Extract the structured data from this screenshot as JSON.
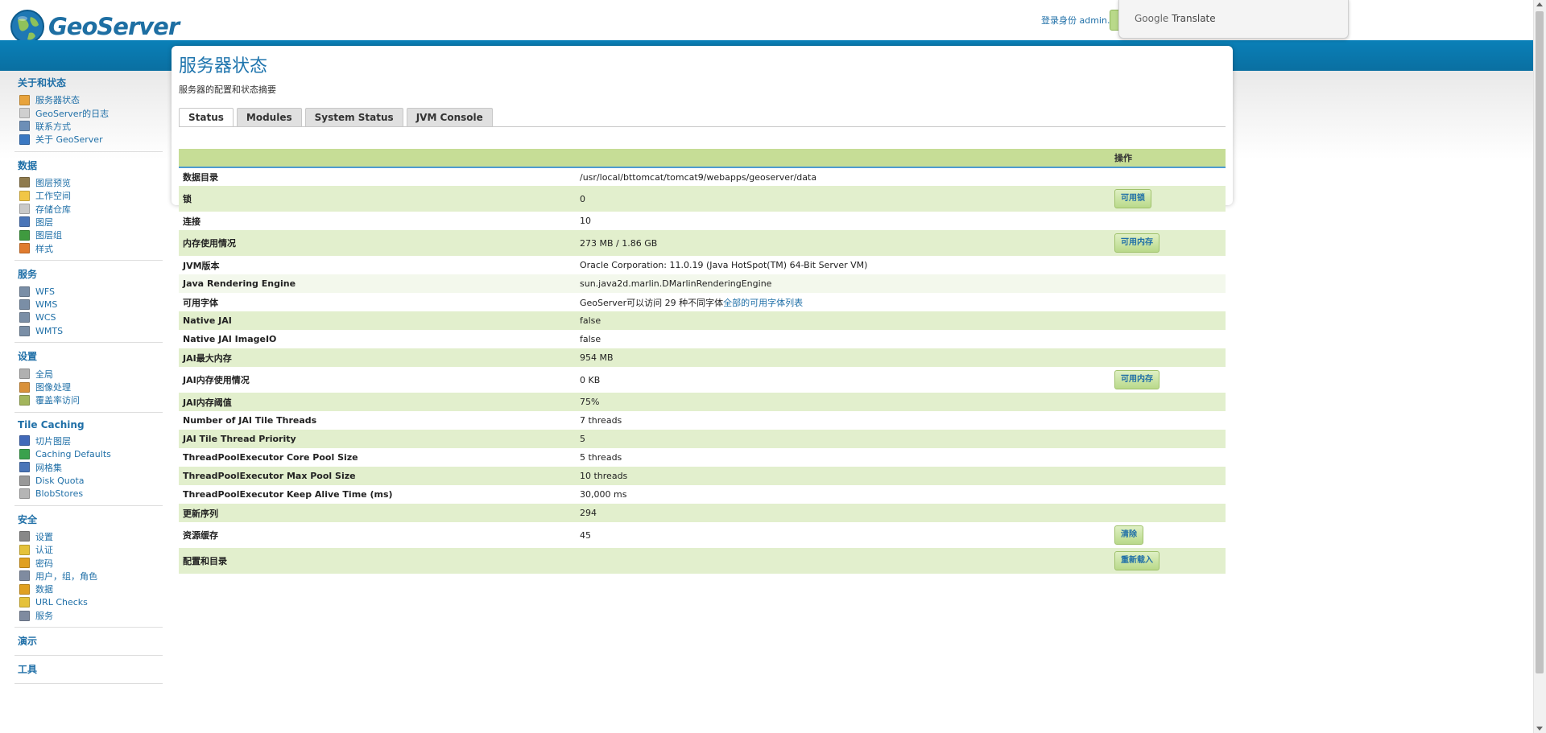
{
  "header": {
    "logo_text": "GeoServer",
    "login_text": "登录身份 admin.",
    "google_translate_label": "Google Translate",
    "google_translate_brand": "Google",
    "google_translate_product": "Translate"
  },
  "sidebar": {
    "sections": [
      {
        "title": "关于和状态",
        "items": [
          "服务器状态",
          "GeoServer的日志",
          "联系方式",
          "关于 GeoServer"
        ]
      },
      {
        "title": "数据",
        "items": [
          "图层预览",
          "工作空间",
          "存储仓库",
          "图层",
          "图层组",
          "样式"
        ]
      },
      {
        "title": "服务",
        "items": [
          "WFS",
          "WMS",
          "WCS",
          "WMTS"
        ]
      },
      {
        "title": "设置",
        "items": [
          "全局",
          "图像处理",
          "覆盖率访问"
        ]
      },
      {
        "title": "Tile Caching",
        "items": [
          "切片图层",
          "Caching Defaults",
          "网格集",
          "Disk Quota",
          "BlobStores"
        ]
      },
      {
        "title": "安全",
        "items": [
          "设置",
          "认证",
          "密码",
          "用户，组，角色",
          "数据",
          "URL Checks",
          "服务"
        ]
      },
      {
        "title": "演示",
        "items": []
      },
      {
        "title": "工具",
        "items": []
      }
    ],
    "icon_colors": [
      "#e8a33b",
      "#cfcfcf",
      "#6d8fb7",
      "#3a78c2",
      "#8f7b4e",
      "#f1c646",
      "#c9c9c9",
      "#4a75b8",
      "#3f9a3f",
      "#e07b2e",
      "#7a8ea6",
      "#7a8ea6",
      "#7a8ea6",
      "#7a8ea6",
      "#b0b0b0",
      "#d9913a",
      "#a3b55c",
      "#4169b8",
      "#3aa14d",
      "#4a75b8",
      "#999999",
      "#b5b5b5",
      "#888888",
      "#e5c23a",
      "#e0a020",
      "#7f8ba0",
      "#e0a020",
      "#e5c23a",
      "#7f8ba0"
    ]
  },
  "page": {
    "title": "服务器状态",
    "description": "服务器的配置和状态摘要",
    "tabs": [
      "Status",
      "Modules",
      "System Status",
      "JVM Console"
    ],
    "table_header_action": "操作"
  },
  "status_rows": [
    {
      "key": "数据目录",
      "value": "/usr/local/bttomcat/tomcat9/webapps/geoserver/data",
      "action": ""
    },
    {
      "key": "锁",
      "value": "0",
      "action": "可用锁"
    },
    {
      "key": "连接",
      "value": "10",
      "action": ""
    },
    {
      "key": "内存使用情况",
      "value": "273 MB / 1.86 GB",
      "action": "可用内存"
    },
    {
      "key": "JVM版本",
      "value": "Oracle Corporation: 11.0.19 (Java HotSpot(TM) 64-Bit Server VM)",
      "action": ""
    },
    {
      "key": "Java Rendering Engine",
      "value": "sun.java2d.marlin.DMarlinRenderingEngine",
      "action": ""
    },
    {
      "key": "可用字体",
      "value": "GeoServer可以访问 29 种不同字体",
      "link": "全部的可用字体列表",
      "action": ""
    },
    {
      "key": "Native JAI",
      "value": "false",
      "action": ""
    },
    {
      "key": "Native JAI ImageIO",
      "value": "false",
      "action": ""
    },
    {
      "key": "JAI最大内存",
      "value": "954 MB",
      "action": ""
    },
    {
      "key": "JAI内存使用情况",
      "value": "0 KB",
      "action": "可用内存"
    },
    {
      "key": "JAI内存阈值",
      "value": "75%",
      "action": ""
    },
    {
      "key": "Number of JAI Tile Threads",
      "value": "7 threads",
      "action": ""
    },
    {
      "key": "JAI Tile Thread Priority",
      "value": "5",
      "action": ""
    },
    {
      "key": "ThreadPoolExecutor Core Pool Size",
      "value": "5 threads",
      "action": ""
    },
    {
      "key": "ThreadPoolExecutor Max Pool Size",
      "value": "10 threads",
      "action": ""
    },
    {
      "key": "ThreadPoolExecutor Keep Alive Time (ms)",
      "value": "30,000 ms",
      "action": ""
    },
    {
      "key": "更新序列",
      "value": "294",
      "action": ""
    },
    {
      "key": "资源缓存",
      "value": "45",
      "action": "清除"
    },
    {
      "key": "配置和目录",
      "value": "",
      "action": "重新载入"
    }
  ]
}
